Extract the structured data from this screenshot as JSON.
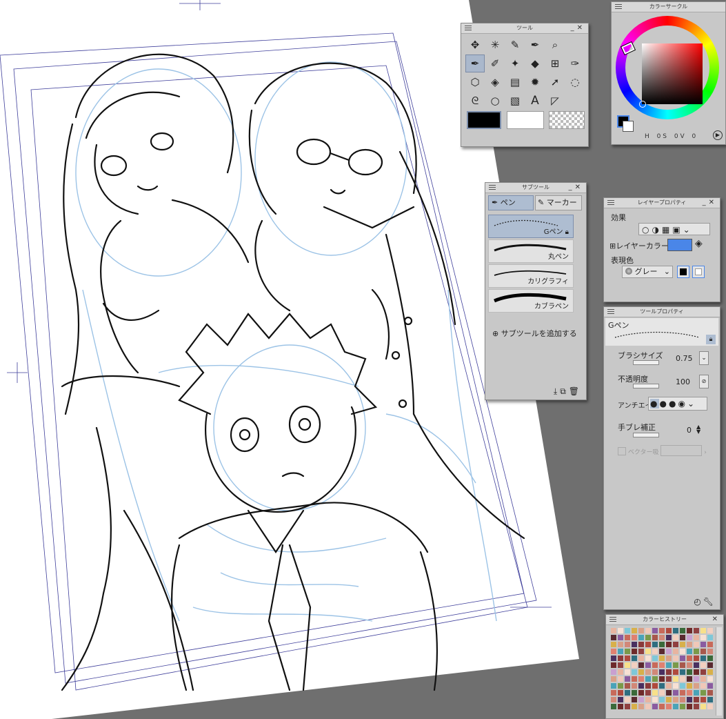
{
  "tool_panel": {
    "title": "ツール",
    "icons": [
      "move-icon",
      "sparkle-icon",
      "eyedropper-icon",
      "pen-nib-icon",
      "zoom-icon",
      "pen-icon",
      "brush-icon",
      "blend-icon",
      "eraser-icon",
      "ruler-icon",
      "nib-outline-icon",
      "cube-icon",
      "fill-icon",
      "gradient-icon",
      "starburst-icon",
      "object-select-icon",
      "lasso-dotted-icon",
      "lasso-icon",
      "ellipse-icon",
      "gradient-box-icon",
      "text-icon",
      "triangle-icon"
    ],
    "text_tool_glyph": "A"
  },
  "color_circle": {
    "title": "カラーサークル",
    "labels": {
      "h": "H",
      "h_val": "0",
      "s": "S",
      "s_val": "0",
      "v": "V",
      "v_val": "0"
    }
  },
  "subtool": {
    "title": "サブツール",
    "tab_pen": "ペン",
    "tab_marker": "マーカー",
    "items": [
      {
        "name": "Gペン",
        "locked": true
      },
      {
        "name": "丸ペン"
      },
      {
        "name": "カリグラフィ"
      },
      {
        "name": "カブラペン"
      }
    ],
    "add_label": "サブツールを追加する"
  },
  "layer_property": {
    "title": "レイヤープロパティ",
    "effect_label": "効果",
    "layer_color_label": "レイヤーカラー",
    "layer_color": "#4a86e8",
    "expression_label": "表現色",
    "expression_value": "グレー"
  },
  "tool_property": {
    "title": "ツールプロパティ",
    "brush_name": "Gペン",
    "brush_size_label": "ブラシサイズ",
    "brush_size_value": "0.75",
    "opacity_label": "不透明度",
    "opacity_value": "100",
    "antialias_label": "アンチエイリ",
    "stabilizer_label": "手ブレ補正",
    "stabilizer_value": "0",
    "vector_label": "ベクター吸"
  },
  "color_history": {
    "title": "カラーヒストリー"
  },
  "colors": {
    "panel_bg": "#c8c8c8",
    "selection": "#aab8cc",
    "sketch_blue": "#9cc3e6"
  }
}
